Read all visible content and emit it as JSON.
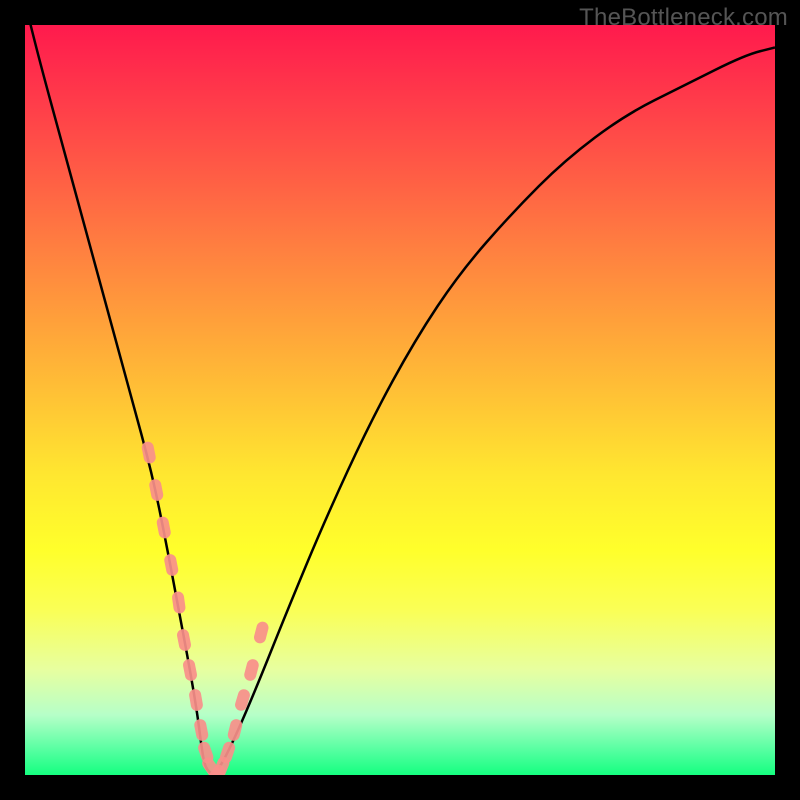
{
  "watermark": "TheBottleneck.com",
  "chart_data": {
    "type": "line",
    "title": "",
    "xlabel": "",
    "ylabel": "",
    "xlim": [
      0,
      100
    ],
    "ylim": [
      0,
      100
    ],
    "series": [
      {
        "name": "bottleneck-curve",
        "x": [
          0,
          2,
          5,
          8,
          11,
          14,
          17,
          19,
          20.5,
          22,
          23,
          23.5,
          24,
          25,
          26,
          28,
          31,
          35,
          40,
          46,
          52,
          58,
          65,
          72,
          80,
          88,
          96,
          100
        ],
        "values": [
          103,
          95,
          84,
          73,
          62,
          51,
          40,
          30,
          22,
          14,
          8,
          4,
          1,
          0,
          1,
          5,
          12,
          22,
          34,
          47,
          58,
          67,
          75,
          82,
          88,
          92,
          96,
          97
        ]
      }
    ],
    "markers": {
      "name": "highlight-points",
      "x": [
        16.5,
        17.5,
        18.5,
        19.5,
        20.5,
        21.2,
        22.0,
        22.8,
        23.5,
        24.1,
        24.8,
        25.5,
        26.2,
        27.0,
        28.0,
        29.0,
        30.2,
        31.5
      ],
      "values": [
        43,
        38,
        33,
        28,
        23,
        18,
        14,
        10,
        6,
        3,
        1,
        0,
        1,
        3,
        6,
        10,
        14,
        19
      ]
    },
    "gradient_bands": [
      {
        "color": "#ff1a4d",
        "stop": 0
      },
      {
        "color": "#ffa23a",
        "stop": 40
      },
      {
        "color": "#ffff2b",
        "stop": 70
      },
      {
        "color": "#15ff80",
        "stop": 100
      }
    ]
  }
}
